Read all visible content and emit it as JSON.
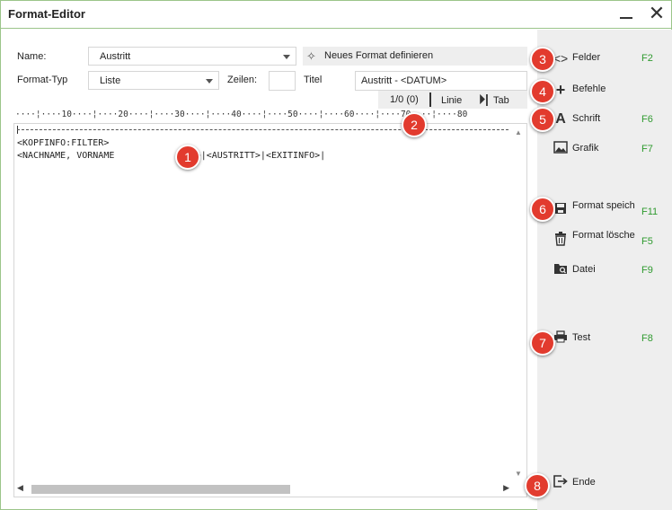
{
  "window": {
    "title": "Format-Editor",
    "minimize_glyph": "",
    "close_glyph": "✕"
  },
  "form": {
    "name_label": "Name:",
    "name_value": "Austritt",
    "formattyp_label": "Format-Typ",
    "formattyp_value": "Liste",
    "zeilen_label": "Zeilen:",
    "zeilen_value": "",
    "titel_label": "Titel",
    "titel_value": "Austritt - <DATUM>",
    "new_format_label": "Neues Format definieren"
  },
  "status": {
    "position": "1/0 (0)",
    "linie": "Linie",
    "tab": "Tab"
  },
  "ruler": "····¦····10····¦····20····¦····30····¦····40····¦····50····¦····60····¦····70····¦····80",
  "editor": {
    "lines": [
      "<KOPFINFO:FILTER>",
      "<NACHNAME, VORNAME               >|<AUSTRITT>|<EXITINFO>|"
    ]
  },
  "commands": [
    {
      "label": "Felder",
      "key": "F2",
      "icon": "code-brackets-icon"
    },
    {
      "label": "Befehle",
      "key": "",
      "icon": "plus-icon"
    },
    {
      "label": "Schrift",
      "key": "F6",
      "icon": "font-icon"
    },
    {
      "label": "Grafik",
      "key": "F7",
      "icon": "image-icon"
    },
    {
      "label": "Format speich",
      "key": "F11",
      "icon": "save-icon"
    },
    {
      "label": "Format lösche",
      "key": "F5",
      "icon": "trash-icon"
    },
    {
      "label": "Datei",
      "key": "F9",
      "icon": "folder-search-icon"
    },
    {
      "label": "Test",
      "key": "F8",
      "icon": "printer-icon"
    },
    {
      "label": "Ende",
      "key": "",
      "icon": "exit-icon"
    }
  ],
  "badges": [
    "1",
    "2",
    "3",
    "4",
    "5",
    "6",
    "7",
    "8"
  ],
  "colors": {
    "badge": "#e23b2e",
    "shortcut": "#2f9a2f",
    "border": "#9bc58a"
  }
}
